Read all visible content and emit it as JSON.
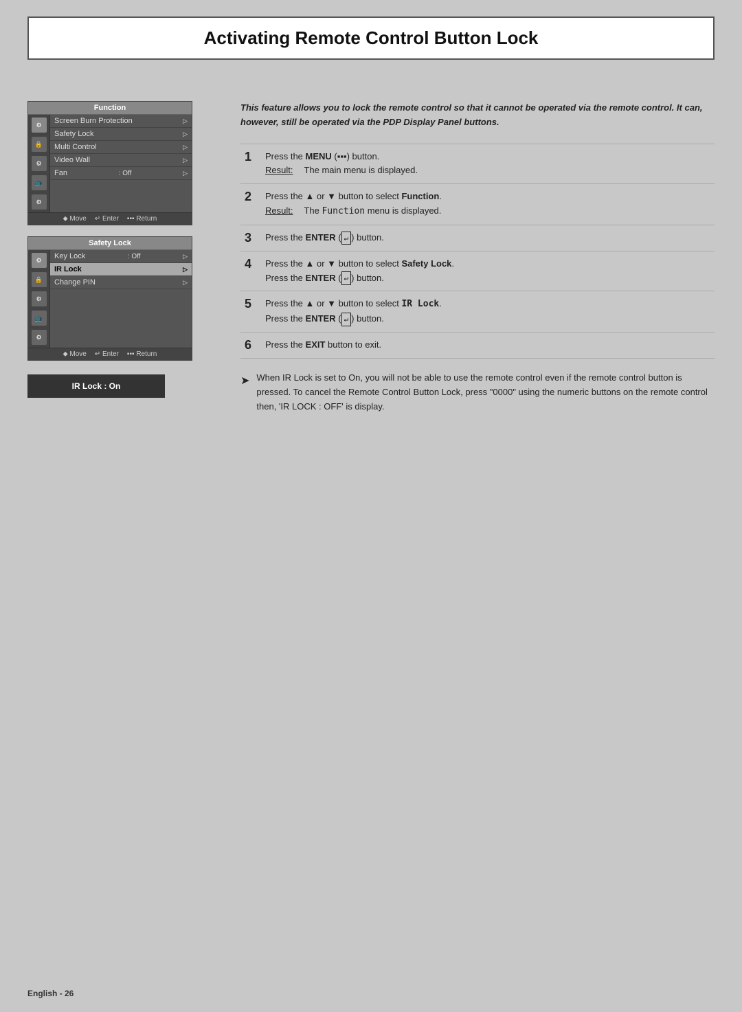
{
  "page": {
    "title": "Activating Remote Control Button Lock",
    "intro": "This feature allows you to lock the remote control so that it cannot be operated via the remote control. It can, however, still be operated via the PDP Display Panel buttons.",
    "footer": "English - 26"
  },
  "menu1": {
    "title": "Function",
    "items": [
      {
        "label": "Screen Burn Protection",
        "value": "",
        "arrow": true,
        "highlighted": false
      },
      {
        "label": "Safety Lock",
        "value": "",
        "arrow": true,
        "highlighted": false
      },
      {
        "label": "Multi Control",
        "value": "",
        "arrow": true,
        "highlighted": false
      },
      {
        "label": "Video Wall",
        "value": "",
        "arrow": true,
        "highlighted": false
      },
      {
        "label": "Fan",
        "value": ": Off",
        "arrow": true,
        "highlighted": false
      }
    ],
    "footer": [
      "Move",
      "Enter",
      "Return"
    ]
  },
  "menu2": {
    "title": "Safety Lock",
    "items": [
      {
        "label": "Key Lock",
        "value": ": Off",
        "arrow": true,
        "highlighted": false
      },
      {
        "label": "IR Lock",
        "value": "",
        "arrow": true,
        "highlighted": true
      },
      {
        "label": "Change PIN",
        "value": "",
        "arrow": true,
        "highlighted": false
      }
    ],
    "footer": [
      "Move",
      "Enter",
      "Return"
    ]
  },
  "ir_lock_box": {
    "text": "IR Lock : On"
  },
  "steps": [
    {
      "number": "1",
      "main": "Press the MENU (▪▪▪) button.",
      "result_label": "Result:",
      "result_text": "The main menu is displayed."
    },
    {
      "number": "2",
      "main": "Press the ▲ or ▼ button to select Function.",
      "result_label": "Result:",
      "result_text": "The Function menu is displayed."
    },
    {
      "number": "3",
      "main": "Press the ENTER (↵) button.",
      "result_label": "",
      "result_text": ""
    },
    {
      "number": "4",
      "main": "Press the ▲ or ▼ button to select Safety Lock.",
      "main2": "Press the ENTER (↵) button.",
      "result_label": "",
      "result_text": ""
    },
    {
      "number": "5",
      "main": "Press the ▲ or ▼ button to select IR Lock.",
      "main2": "Press the ENTER (↵) button.",
      "result_label": "",
      "result_text": ""
    },
    {
      "number": "6",
      "main": "Press the EXIT button to exit.",
      "result_label": "",
      "result_text": ""
    }
  ],
  "note": "When IR Lock is set to On, you will not be able to use the remote control even if the remote control button is pressed. To cancel the Remote Control Button Lock, press \"0000\" using the numeric buttons on the remote control then, 'IR LOCK : OFF' is display."
}
